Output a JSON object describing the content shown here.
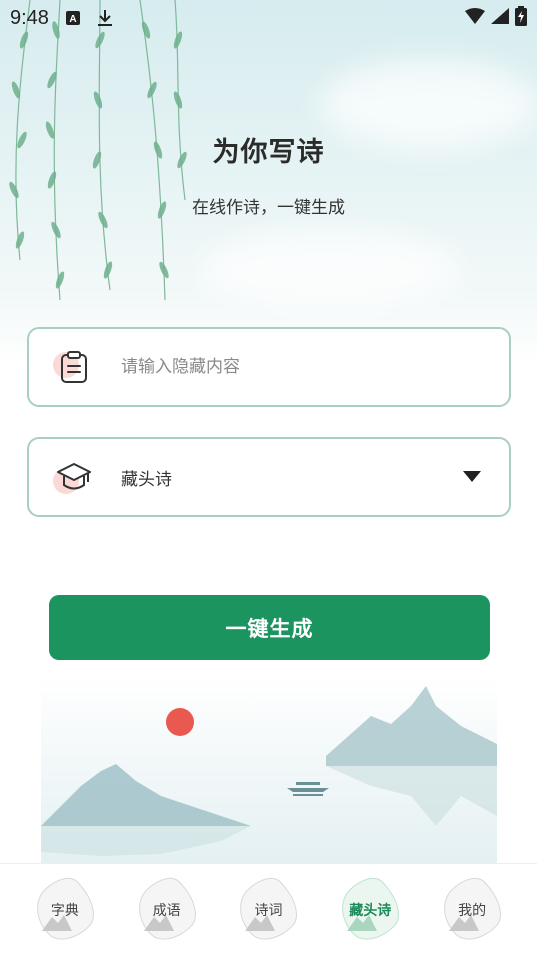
{
  "status_bar": {
    "time": "9:48",
    "icons": [
      "notification-a-icon",
      "download-icon",
      "wifi-icon",
      "signal-icon",
      "battery-charging-icon"
    ]
  },
  "header": {
    "title": "为你写诗",
    "subtitle": "在线作诗，一键生成"
  },
  "form": {
    "content_input": {
      "icon": "clipboard-icon",
      "placeholder": "请输入隐藏内容",
      "value": ""
    },
    "type_select": {
      "icon": "graduation-cap-icon",
      "selected": "藏头诗"
    },
    "generate_label": "一键生成"
  },
  "tabs": [
    {
      "label": "字典",
      "active": false
    },
    {
      "label": "成语",
      "active": false
    },
    {
      "label": "诗词",
      "active": false
    },
    {
      "label": "藏头诗",
      "active": true
    },
    {
      "label": "我的",
      "active": false
    }
  ],
  "colors": {
    "accent": "#1b9460",
    "field_border": "#a9cfc1",
    "sun": "#e8473c"
  }
}
